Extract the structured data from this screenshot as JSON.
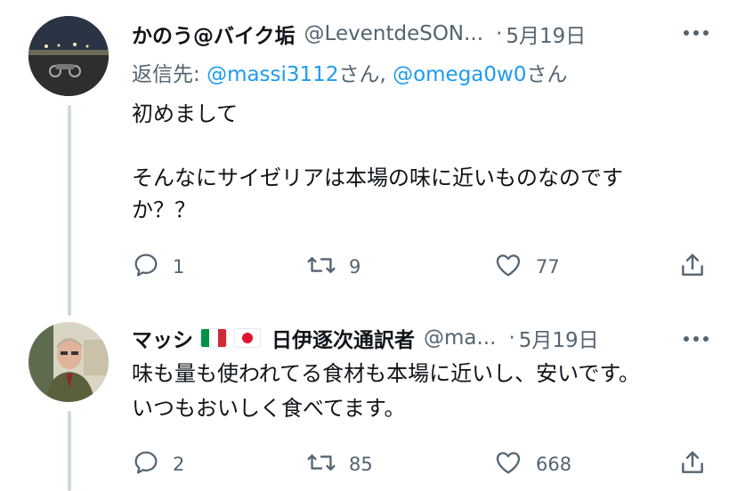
{
  "tweets": [
    {
      "display_name": "かのう@バイク垢",
      "handle": "@LeventdeSON...",
      "separator": "·",
      "date": "5月19日",
      "reply_prefix": "返信先: ",
      "reply_mention_1": "@massi3112",
      "reply_san_1": "さん, ",
      "reply_mention_2": "@omega0w0",
      "reply_san_2": "さん",
      "text_lines": [
        "初めまして",
        "そんなにサイゼリアは本場の味に近いものなのです",
        "か？？"
      ],
      "replies": "1",
      "retweets": "9",
      "likes": "77"
    },
    {
      "display_name": "マッシ",
      "flags": [
        "italy-flag",
        "japan-flag"
      ],
      "display_name_suffix": "日伊逐次通訳者",
      "handle": "@ma...",
      "separator": "·",
      "date": "5月19日",
      "text_lines": [
        "味も量も使われてる食材も本場に近いし、安いです。",
        "いつもおいしく食べてます。"
      ],
      "replies": "2",
      "retweets": "85",
      "likes": "668"
    }
  ],
  "colors": {
    "text": "#0f1419",
    "secondary": "#536471",
    "link": "#1d9bf0",
    "thread_line": "#cfd9de"
  },
  "icons": [
    "more-icon",
    "reply-icon",
    "retweet-icon",
    "like-icon",
    "share-icon"
  ]
}
